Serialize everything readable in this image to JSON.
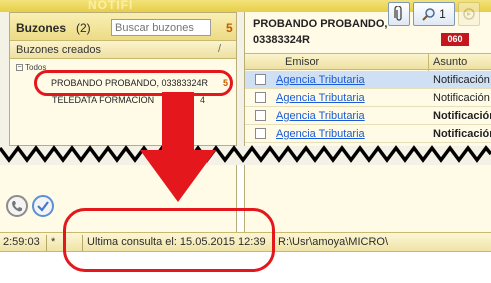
{
  "header": {
    "watermark_text": "NOTIFI"
  },
  "left_pane": {
    "title": "Buzones",
    "count": "(2)",
    "search_placeholder": "Buscar buzones",
    "search_count": "5",
    "column_header": "Buzones creados",
    "column_sep": "/",
    "tree": {
      "root_label": "Todos",
      "items": [
        {
          "label": "PROBANDO PROBANDO, 03383324R",
          "count": "5",
          "highlighted": true
        },
        {
          "label": "TELEDATA FORMACION",
          "count": "4",
          "highlighted": false
        }
      ]
    }
  },
  "right_pane": {
    "title_line1": "PROBANDO PROBANDO,",
    "title_line2": "03383324R",
    "badge": "060",
    "toolbar": {
      "search_count": "1"
    },
    "columns": {
      "emisor": "Emisor",
      "asunto": "Asunto"
    },
    "rows": [
      {
        "emisor": "Agencia Tributaria",
        "asunto": "Notificación",
        "bold": false,
        "selected": true
      },
      {
        "emisor": "Agencia Tributaria",
        "asunto": "Notificación",
        "bold": false,
        "selected": false
      },
      {
        "emisor": "Agencia Tributaria",
        "asunto": "Notificación",
        "bold": true,
        "selected": false
      },
      {
        "emisor": "Agencia Tributaria",
        "asunto": "Notificación",
        "bold": true,
        "selected": false
      }
    ]
  },
  "status_bar": {
    "time": "2:59:03",
    "star": "*",
    "consulta": "Ultima consulta el: 15.05.2015 12:39",
    "path": "R:\\Usr\\amoya\\MICRO\\"
  },
  "colors": {
    "annotation": "#e3171c",
    "accent_orange": "#c45a00",
    "link": "#1a5bd6",
    "badge": "#c4161c"
  },
  "icons": [
    "attach-icon",
    "search-icon",
    "disabled-action-icon",
    "phone-icon",
    "check-icon",
    "expand-icon"
  ]
}
